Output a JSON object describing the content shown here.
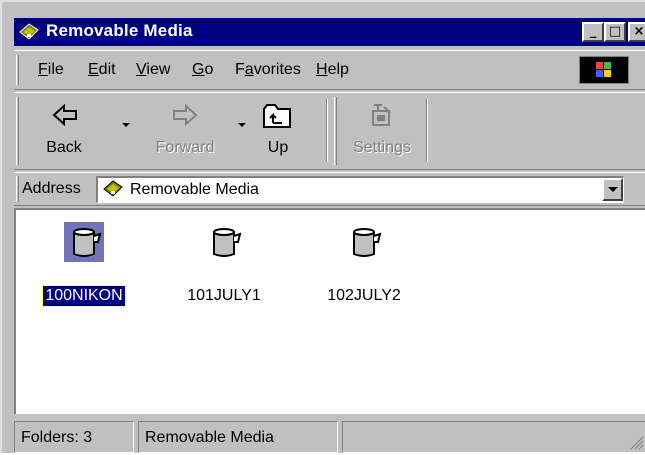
{
  "window": {
    "title": "Removable Media",
    "title_icon": "removable-drive-icon",
    "controls": {
      "minimize": "_",
      "maximize": "□",
      "close": "×"
    }
  },
  "menu": {
    "items": [
      {
        "label": "File",
        "accel": "F"
      },
      {
        "label": "Edit",
        "accel": "E"
      },
      {
        "label": "View",
        "accel": "V"
      },
      {
        "label": "Go",
        "accel": "G"
      },
      {
        "label": "Favorites",
        "accel": "a"
      },
      {
        "label": "Help",
        "accel": "H"
      }
    ],
    "logo": "windows-logo-icon"
  },
  "toolbar": {
    "back": {
      "label": "Back",
      "icon": "back-arrow-icon"
    },
    "forward": {
      "label": "Forward",
      "icon": "forward-arrow-icon"
    },
    "up": {
      "label": "Up",
      "icon": "up-folder-icon"
    },
    "settings": {
      "label": "Settings",
      "icon": "settings-icon"
    }
  },
  "address": {
    "label": "Address",
    "value": "Removable Media",
    "icon": "removable-drive-icon"
  },
  "folders": [
    {
      "name": "100NIKON",
      "selected": true,
      "icon": "camera-folder-icon"
    },
    {
      "name": "101JULY1",
      "selected": false,
      "icon": "camera-folder-icon"
    },
    {
      "name": "102JULY2",
      "selected": false,
      "icon": "camera-folder-icon"
    }
  ],
  "status": {
    "count": "Folders: 3",
    "location": "Removable Media"
  },
  "colors": {
    "titlebar": "#000080",
    "face": "#c0c0c0",
    "selection": "#000080"
  }
}
